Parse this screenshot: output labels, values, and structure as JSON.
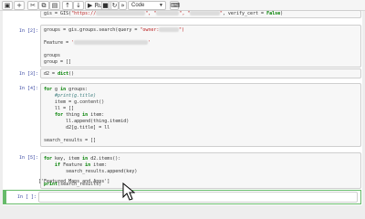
{
  "toolbar": {
    "run_label": "Run",
    "cell_type": "Code",
    "icons": [
      "save-icon",
      "add-icon",
      "cut-icon",
      "copy-icon",
      "paste-icon",
      "move-up-icon",
      "move-down-icon",
      "run-icon",
      "stop-icon",
      "restart-icon",
      "fast-forward-icon",
      "keyboard-icon"
    ]
  },
  "cells": [
    {
      "prompt": "",
      "lines": [
        {
          "id": "c0l0",
          "parts": [
            {
              "t": "gis = GIS(",
              "c": ""
            },
            {
              "t": "\"https://",
              "c": "str"
            },
            {
              "blur": 60
            },
            {
              "t": "\", \"",
              "c": "str"
            },
            {
              "blur": 28
            },
            {
              "t": "\", \"",
              "c": "str"
            },
            {
              "blur": 36
            },
            {
              "t": "\"",
              "c": "str"
            },
            {
              "t": ", verify_cert = ",
              "c": ""
            },
            {
              "t": "False",
              "c": "kw"
            },
            {
              "t": ")",
              "c": ""
            }
          ]
        }
      ]
    },
    {
      "prompt": "In [2]:",
      "lines": [
        {
          "id": "c1l0",
          "parts": [
            {
              "t": "groups = gis.groups.search(query = ",
              "c": ""
            },
            {
              "t": "\"owner:",
              "c": "str"
            },
            {
              "blur": 24
            },
            {
              "t": "\")",
              "c": "str"
            }
          ]
        },
        {
          "id": "c1l1",
          "parts": [
            {
              "t": "",
              "c": ""
            }
          ]
        },
        {
          "id": "c1l2",
          "parts": [
            {
              "t": "Feature = ",
              "c": ""
            },
            {
              "t": "'",
              "c": "str"
            },
            {
              "blur": 90
            },
            {
              "t": "'",
              "c": "str"
            }
          ]
        },
        {
          "id": "c1l3",
          "parts": [
            {
              "t": "",
              "c": ""
            }
          ]
        },
        {
          "id": "c1l4",
          "parts": [
            {
              "t": "groups",
              "c": ""
            }
          ]
        },
        {
          "id": "c1l5",
          "parts": [
            {
              "t": "group = []",
              "c": ""
            }
          ]
        }
      ]
    },
    {
      "prompt": "In [3]:",
      "lines": [
        {
          "id": "c2l0",
          "parts": [
            {
              "t": "d2 = ",
              "c": ""
            },
            {
              "t": "dict",
              "c": "kw"
            },
            {
              "t": "()",
              "c": ""
            }
          ]
        }
      ]
    },
    {
      "prompt": "In [4]:",
      "lines": [
        {
          "id": "c3l0",
          "parts": [
            {
              "t": "for",
              "c": "kw"
            },
            {
              "t": " g ",
              "c": ""
            },
            {
              "t": "in",
              "c": "kw"
            },
            {
              "t": " groups:",
              "c": ""
            }
          ]
        },
        {
          "id": "c3l1",
          "parts": [
            {
              "t": "    #print(g.title)",
              "c": "cm"
            }
          ]
        },
        {
          "id": "c3l2",
          "parts": [
            {
              "t": "    item = g.content()",
              "c": ""
            }
          ]
        },
        {
          "id": "c3l3",
          "parts": [
            {
              "t": "    ll = []",
              "c": ""
            }
          ]
        },
        {
          "id": "c3l4",
          "parts": [
            {
              "t": "    ",
              "c": ""
            },
            {
              "t": "for",
              "c": "kw"
            },
            {
              "t": " thing ",
              "c": ""
            },
            {
              "t": "in",
              "c": "kw"
            },
            {
              "t": " item:",
              "c": ""
            }
          ]
        },
        {
          "id": "c3l5",
          "parts": [
            {
              "t": "        ll.append(thing.itemid)",
              "c": ""
            }
          ]
        },
        {
          "id": "c3l6",
          "parts": [
            {
              "t": "        d2[g.title] = ll",
              "c": ""
            }
          ]
        },
        {
          "id": "c3l7",
          "parts": [
            {
              "t": "",
              "c": ""
            }
          ]
        },
        {
          "id": "c3l8",
          "parts": [
            {
              "t": "search_results = []",
              "c": ""
            }
          ]
        }
      ]
    },
    {
      "prompt": "In [5]:",
      "lines": [
        {
          "id": "c4l0",
          "parts": [
            {
              "t": "for",
              "c": "kw"
            },
            {
              "t": " key, item ",
              "c": ""
            },
            {
              "t": "in",
              "c": "kw"
            },
            {
              "t": " d2.items():",
              "c": ""
            }
          ]
        },
        {
          "id": "c4l1",
          "parts": [
            {
              "t": "    ",
              "c": ""
            },
            {
              "t": "if",
              "c": "kw"
            },
            {
              "t": " Feature ",
              "c": ""
            },
            {
              "t": "in",
              "c": "kw"
            },
            {
              "t": " item:",
              "c": ""
            }
          ]
        },
        {
          "id": "c4l2",
          "parts": [
            {
              "t": "        search_results.append(key)",
              "c": ""
            }
          ]
        },
        {
          "id": "c4l3",
          "parts": [
            {
              "t": "",
              "c": ""
            }
          ]
        },
        {
          "id": "c4l4",
          "parts": [
            {
              "t": "print",
              "c": "kw"
            },
            {
              "t": "(search_results)",
              "c": ""
            }
          ]
        }
      ]
    }
  ],
  "output_text": "['Featured Maps and Apps']",
  "empty_prompt": "In [ ]:"
}
